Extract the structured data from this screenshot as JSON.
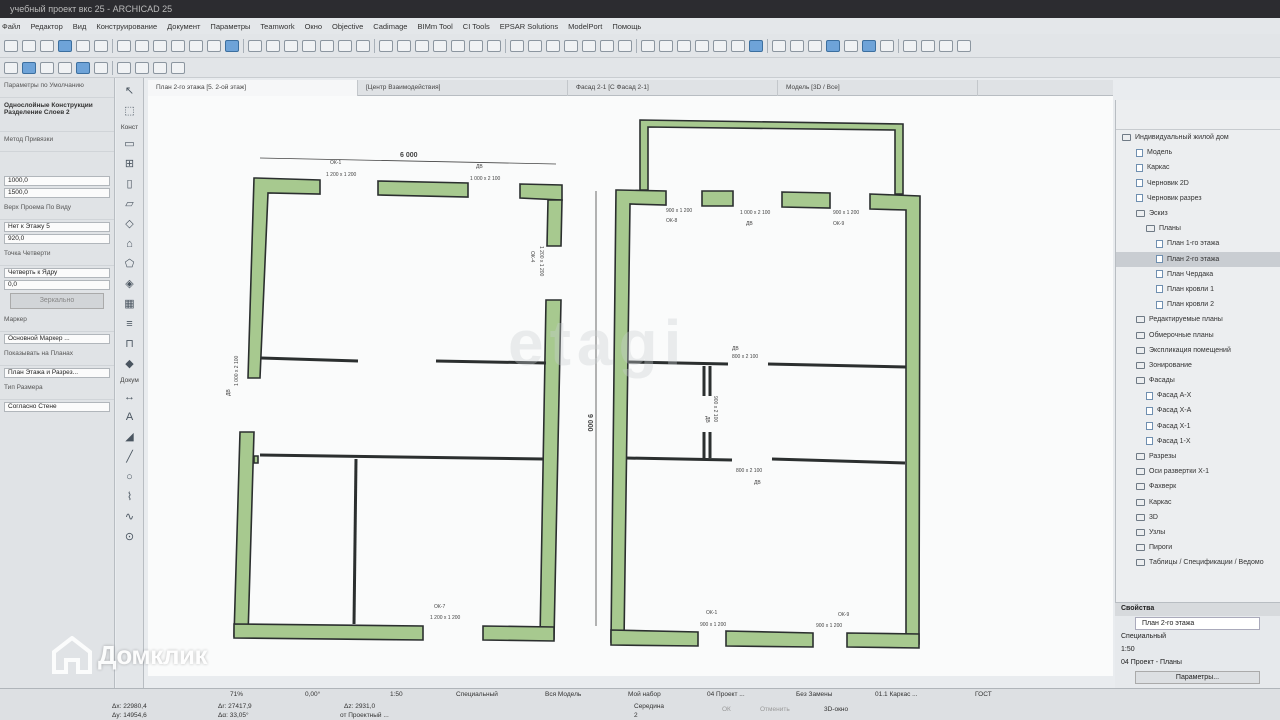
{
  "window": {
    "title": "учебный проект вкс 25 - ARCHICAD 25"
  },
  "menu": [
    "Файл",
    "Редактор",
    "Вид",
    "Конструирование",
    "Документ",
    "Параметры",
    "Teamwork",
    "Окно",
    "Objective",
    "Cadimage",
    "BIMm Tool",
    "CI Tools",
    "EPSAR Solutions",
    "ModelPort",
    "Помощь"
  ],
  "tabs": [
    {
      "label": "План 2-го этажа [5. 2-ой этаж]",
      "active": true
    },
    {
      "label": "[Центр Взаимодействия]",
      "active": false
    },
    {
      "label": "Фасад 2-1 [С Фасад 2-1]",
      "active": false
    },
    {
      "label": "Модель [3D / Все]",
      "active": false
    }
  ],
  "info_panel": {
    "element_label": "Параметры по Умолчанию",
    "element_name": "Однослойные Конструкции Разделение Слоев 2",
    "geometry_label": "Метод Привязки",
    "size_a": "1000,0",
    "size_b": "1500,0",
    "story_label": "Верх Проема По Виду",
    "story_link": "Нет к Этажу 5",
    "height_val": "920,0",
    "anchor_label": "Точка Четверти",
    "anchor_val": "Четверть к Ядру",
    "offset_val": "0,0",
    "mirror_label": "Зеркально",
    "marker_label": "Маркер",
    "marker_val": "Основной Маркер ...",
    "doc_tab": "Докум",
    "show_label": "Показывать на Планах",
    "show_val": "План Этажа и Разрез...",
    "dim_label": "Тип Размера",
    "dim_val": "Согласно Стене",
    "panel_tab": "Конст"
  },
  "drawing": {
    "watermark": "etagi",
    "dims": {
      "width": "6 000",
      "height": "9 000"
    },
    "left_labels": [
      {
        "text": "ОК-1",
        "sub": "1 200 x 1 200"
      },
      {
        "text": "ДВ",
        "sub": "1 000 x 2 100"
      },
      {
        "text": "1 000 x 2 100",
        "sub": "ДВ"
      },
      {
        "text": "ОК-7",
        "sub": "1 200 x 1 200"
      },
      {
        "text": "ОК-4",
        "sub": "1 200 x 1 200"
      }
    ],
    "right_labels": [
      {
        "text": "900 x 1 200",
        "sub": "ОК-8"
      },
      {
        "text": "1 000 x 2 100",
        "sub": "ДВ"
      },
      {
        "text": "900 x 1 200",
        "sub": "ОК-9"
      },
      {
        "text": "ДВ",
        "sub": "800 x 2 100"
      },
      {
        "text": "900 x 2 100",
        "sub": "ДВ"
      },
      {
        "text": "800 x 2 100",
        "sub": "ДВ"
      },
      {
        "text": "ОК-1",
        "sub": "900 x 1 200"
      },
      {
        "text": "ОК-9",
        "sub": "900 x 1 200"
      }
    ]
  },
  "navigator": {
    "root": "Индивидуальный жилой дом",
    "items": [
      {
        "label": "Модель",
        "level": 1,
        "kind": "doc"
      },
      {
        "label": "Каркас",
        "level": 1,
        "kind": "doc"
      },
      {
        "label": "Черновик 2D",
        "level": 1,
        "kind": "doc"
      },
      {
        "label": "Черновик разрез",
        "level": 1,
        "kind": "doc"
      },
      {
        "label": "Эскиз",
        "level": 1,
        "kind": "folder"
      },
      {
        "label": "Планы",
        "level": 2,
        "kind": "folder"
      },
      {
        "label": "План 1-го этажа",
        "level": 3,
        "kind": "doc"
      },
      {
        "label": "План 2-го этажа",
        "level": 3,
        "kind": "doc",
        "selected": true
      },
      {
        "label": "План Чердака",
        "level": 3,
        "kind": "doc"
      },
      {
        "label": "План кровли 1",
        "level": 3,
        "kind": "doc"
      },
      {
        "label": "План кровли 2",
        "level": 3,
        "kind": "doc"
      },
      {
        "label": "Редактируемые планы",
        "level": 1,
        "kind": "folder"
      },
      {
        "label": "Обмерочные планы",
        "level": 1,
        "kind": "folder"
      },
      {
        "label": "Экспликация помещений",
        "level": 1,
        "kind": "folder"
      },
      {
        "label": "Зонирование",
        "level": 1,
        "kind": "folder"
      },
      {
        "label": "Фасады",
        "level": 1,
        "kind": "folder"
      },
      {
        "label": "Фасад А-Х",
        "level": 2,
        "kind": "doc"
      },
      {
        "label": "Фасад Х-А",
        "level": 2,
        "kind": "doc"
      },
      {
        "label": "Фасад Х-1",
        "level": 2,
        "kind": "doc"
      },
      {
        "label": "Фасад 1-Х",
        "level": 2,
        "kind": "doc"
      },
      {
        "label": "Разрезы",
        "level": 1,
        "kind": "folder"
      },
      {
        "label": "Оси развертки Х-1",
        "level": 1,
        "kind": "folder"
      },
      {
        "label": "Фахверк",
        "level": 1,
        "kind": "folder"
      },
      {
        "label": "Каркас",
        "level": 1,
        "kind": "folder"
      },
      {
        "label": "3D",
        "level": 1,
        "kind": "folder"
      },
      {
        "label": "Узлы",
        "level": 1,
        "kind": "folder"
      },
      {
        "label": "Пироги",
        "level": 1,
        "kind": "folder"
      },
      {
        "label": "Таблицы / Спецификации / Ведомо",
        "level": 1,
        "kind": "folder"
      }
    ]
  },
  "properties": {
    "header": "Свойства",
    "name": "План 2-го этажа",
    "rows": [
      "Специальный",
      "1:50",
      "04 Проект - Планы"
    ],
    "button": "Параметры..."
  },
  "status": {
    "zoom": "71%",
    "angle": "0,00°",
    "scale": "1:50",
    "layer_combo": "Специальный",
    "model": "Вся Модель",
    "pen_set": "Мой набор",
    "project": "04 Проект ...",
    "override": "Без Замены",
    "renovation": "01.1 Каркас ...",
    "dim_std": "ГОСТ",
    "coord_x": "Δх: 22980,4",
    "coord_y": "Δу: 14954,6",
    "coord_r": "Δr: 27417,9",
    "coord_a": "Δα: 33,05°",
    "coord_z": "Δz: 2931,0",
    "ref": "от Проектный ...",
    "snap": "Середина",
    "snap_n": "2",
    "ok": "ОК",
    "cancel": "Отменить",
    "view3d": "3D-окно"
  },
  "logo": {
    "text": "Домклик"
  }
}
